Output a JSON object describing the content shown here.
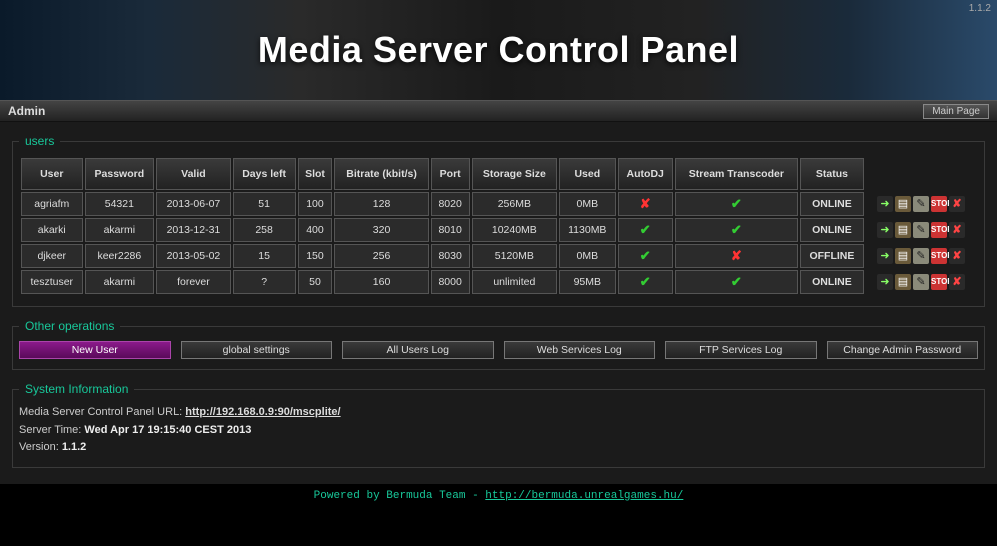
{
  "version_top": "1.1.2",
  "title": "Media Server Control Panel",
  "topbar": {
    "section": "Admin",
    "main_page": "Main Page"
  },
  "users": {
    "legend": "users",
    "headers": [
      "User",
      "Password",
      "Valid",
      "Days left",
      "Slot",
      "Bitrate (kbit/s)",
      "Port",
      "Storage Size",
      "Used",
      "AutoDJ",
      "Stream Transcoder",
      "Status"
    ],
    "rows": [
      {
        "user": "agriafm",
        "password": "54321",
        "valid": "2013-06-07",
        "days_left": "51",
        "slot": "100",
        "bitrate": "128",
        "port": "8020",
        "storage": "256MB",
        "used": "0MB",
        "used_class": "green",
        "autodj": false,
        "transcoder": true,
        "status": "ONLINE"
      },
      {
        "user": "akarki",
        "password": "akarmi",
        "valid": "2013-12-31",
        "days_left": "258",
        "slot": "400",
        "bitrate": "320",
        "port": "8010",
        "storage": "10240MB",
        "used": "1130MB",
        "used_class": "green",
        "autodj": true,
        "transcoder": true,
        "status": "ONLINE"
      },
      {
        "user": "djkeer",
        "password": "keer2286",
        "valid": "2013-05-02",
        "days_left": "15",
        "slot": "150",
        "bitrate": "256",
        "port": "8030",
        "storage": "5120MB",
        "used": "0MB",
        "used_class": "green",
        "autodj": true,
        "transcoder": false,
        "status": "OFFLINE"
      },
      {
        "user": "tesztuser",
        "password": "akarmi",
        "valid": "forever",
        "days_left": "?",
        "slot": "50",
        "bitrate": "160",
        "port": "8000",
        "storage": "unlimited",
        "used": "95MB",
        "used_class": "green",
        "autodj": true,
        "transcoder": true,
        "status": "ONLINE"
      }
    ]
  },
  "ops": {
    "legend": "Other operations",
    "new_user": "New User",
    "global_settings": "global settings",
    "all_users_log": "All Users Log",
    "web_services_log": "Web Services Log",
    "ftp_services_log": "FTP Services Log",
    "change_admin_pw": "Change Admin Password"
  },
  "sysinfo": {
    "legend": "System Information",
    "url_label": "Media Server Control Panel URL: ",
    "url": "http://192.168.0.9:90/mscplite/",
    "time_label": "Server Time: ",
    "time": "Wed Apr 17 19:15:40 CEST 2013",
    "version_label": "Version: ",
    "version": "1.1.2"
  },
  "footer": {
    "text": "Powered by Bermuda Team - ",
    "link": "http://bermuda.unrealgames.hu/"
  }
}
